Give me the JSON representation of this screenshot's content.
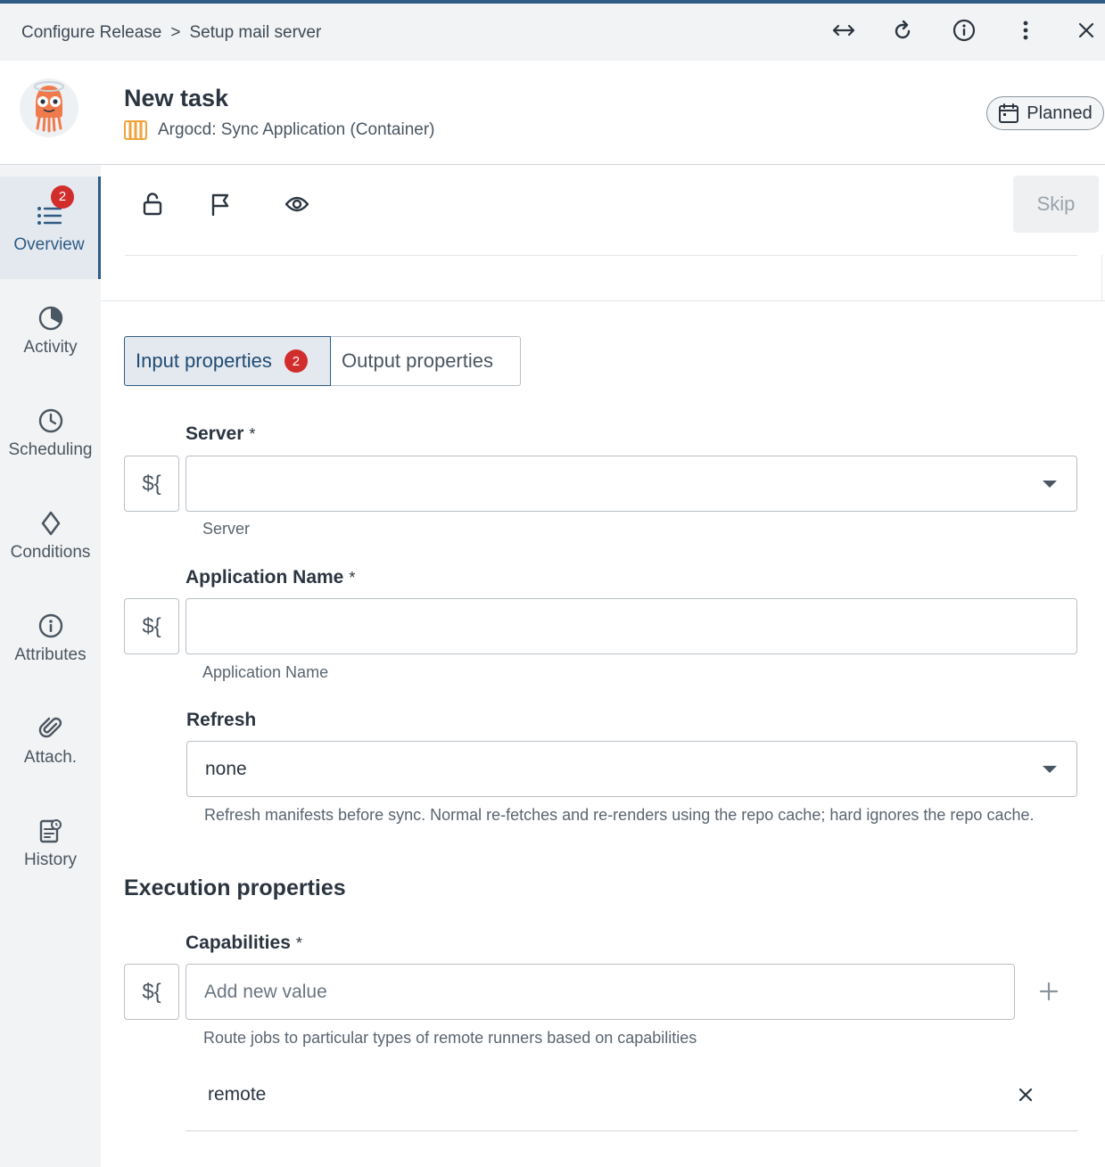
{
  "breadcrumb": {
    "parent": "Configure Release",
    "separator": ">",
    "current": "Setup mail server"
  },
  "header": {
    "title": "New task",
    "task_type": "Argocd: Sync Application (Container)",
    "status_label": "Planned"
  },
  "sidebar": {
    "items": [
      {
        "label": "Overview",
        "icon": "list-icon",
        "badge": "2",
        "active": true
      },
      {
        "label": "Activity",
        "icon": "pie-chart-icon"
      },
      {
        "label": "Scheduling",
        "icon": "clock-icon"
      },
      {
        "label": "Conditions",
        "icon": "diamond-icon"
      },
      {
        "label": "Attributes",
        "icon": "info-icon"
      },
      {
        "label": "Attach.",
        "icon": "paperclip-icon"
      },
      {
        "label": "History",
        "icon": "history-icon"
      }
    ]
  },
  "toolbar": {
    "skip_label": "Skip"
  },
  "tabs": {
    "input_label": "Input properties",
    "input_badge": "2",
    "output_label": "Output properties"
  },
  "fields": {
    "var_symbol": "${",
    "required_mark": "*",
    "server": {
      "label": "Server",
      "value": "",
      "helper": "Server"
    },
    "application_name": {
      "label": "Application Name",
      "value": "",
      "helper": "Application Name"
    },
    "refresh": {
      "label": "Refresh",
      "value": "none",
      "helper": "Refresh manifests before sync. Normal re-fetches and re-renders using the repo cache; hard ignores the repo cache."
    }
  },
  "execution": {
    "title": "Execution properties",
    "capabilities": {
      "label": "Capabilities",
      "placeholder": "Add new value",
      "helper": "Route jobs to particular types of remote runners based on capabilities",
      "values": [
        "remote"
      ]
    }
  },
  "colors": {
    "accent": "#2f5b84",
    "badge": "#d22d2d",
    "sidebar_bg": "#f2f3f4",
    "text": "#2b3540"
  }
}
